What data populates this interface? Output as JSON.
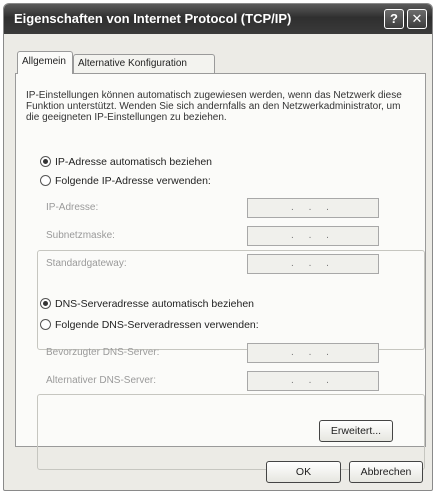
{
  "window": {
    "title": "Eigenschaften von Internet Protocol (TCP/IP)",
    "help_label": "?",
    "close_label": "✕"
  },
  "tabs": [
    {
      "label": "Allgemein",
      "active": true
    },
    {
      "label": "Alternative Konfiguration",
      "active": false
    }
  ],
  "description": "IP-Einstellungen können automatisch zugewiesen werden, wenn das Netzwerk diese Funktion unterstützt. Wenden Sie sich andernfalls an den Netzwerkadministrator, um die geeigneten IP-Einstellungen zu beziehen.",
  "ip": {
    "auto_label": "IP-Adresse automatisch beziehen",
    "auto_checked": true,
    "manual_label": "Folgende IP-Adresse verwenden:",
    "manual_checked": false,
    "fields": [
      {
        "label": "IP-Adresse:",
        "value": ".   .   ."
      },
      {
        "label": "Subnetzmaske:",
        "value": ".   .   ."
      },
      {
        "label": "Standardgateway:",
        "value": ".   .   ."
      }
    ]
  },
  "dns": {
    "auto_label": "DNS-Serveradresse automatisch beziehen",
    "auto_checked": true,
    "manual_label": "Folgende DNS-Serveradressen verwenden:",
    "manual_checked": false,
    "fields": [
      {
        "label": "Bevorzugter DNS-Server:",
        "value": ".   .   ."
      },
      {
        "label": "Alternativer DNS-Server:",
        "value": ".   .   ."
      }
    ]
  },
  "buttons": {
    "advanced": "Erweitert...",
    "ok": "OK",
    "cancel": "Abbrechen"
  }
}
